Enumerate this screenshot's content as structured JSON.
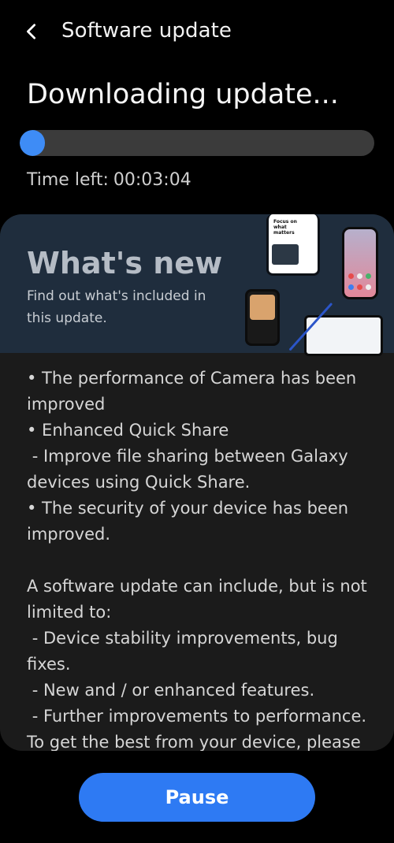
{
  "header": {
    "back_icon": "chevron-left-icon",
    "title": "Software update"
  },
  "status": {
    "heading": "Downloading update...",
    "progress_fraction": 0.07,
    "time_left_label": "Time left:",
    "time_left_value": "00:03:04"
  },
  "whats_new": {
    "title": "What's new",
    "subtitle": "Find out what's included in this update.",
    "banner_device_caption": "Focus on what matters"
  },
  "release_notes": "• The performance of Camera has been improved\n• Enhanced Quick Share\n - Improve file sharing between Galaxy devices using Quick Share.\n• The security of your device has been improved.\n\nA software update can include, but is not limited to:\n - Device stability improvements, bug fixes.\n - New and / or enhanced features.\n - Further improvements to performance.\nTo get the best from your device, please",
  "actions": {
    "pause_label": "Pause"
  },
  "colors": {
    "accent": "#2e7af3",
    "progress_fill": "#3e8cf6",
    "progress_track": "#3b3b3b",
    "banner_bg": "#1f2d3d"
  }
}
